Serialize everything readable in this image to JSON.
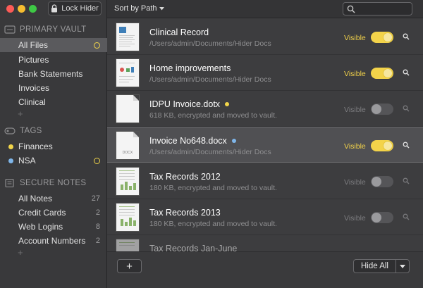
{
  "titlebar": {
    "lock_label": "Lock Hider"
  },
  "toolbar": {
    "sort_label": "Sort by Path",
    "search_placeholder": ""
  },
  "sidebar": {
    "vault_header": "PRIMARY VAULT",
    "vault_items": [
      {
        "label": "All Files",
        "selected": true
      },
      {
        "label": "Pictures"
      },
      {
        "label": "Bank Statements"
      },
      {
        "label": "Invoices"
      },
      {
        "label": "Clinical"
      }
    ],
    "tags_header": "TAGS",
    "tags": [
      {
        "label": "Finances",
        "color": "#f1d54a"
      },
      {
        "label": "NSA",
        "color": "#7fb6ea"
      }
    ],
    "notes_header": "SECURE NOTES",
    "notes": [
      {
        "label": "All Notes",
        "count": "27"
      },
      {
        "label": "Credit Cards",
        "count": "2"
      },
      {
        "label": "Web Logins",
        "count": "8"
      },
      {
        "label": "Account Numbers",
        "count": "2"
      }
    ]
  },
  "files": [
    {
      "name": "Clinical Record",
      "sub": "/Users/admin/Documents/Hider Docs",
      "status": "Visible",
      "visible": true
    },
    {
      "name": "Home improvements",
      "sub": "/Users/admin/Documents/Hider Docs",
      "status": "Visible",
      "visible": true
    },
    {
      "name": "IDPU Invoice.dotx",
      "sub": "618 KB, encrypted and moved to vault.",
      "status": "Visible",
      "visible": false,
      "tag_color": "#f1d54a"
    },
    {
      "name": "Invoice No648.docx",
      "sub": "/Users/admin/Documents/Hider Docs",
      "status": "Visible",
      "visible": true,
      "tag_color": "#7fb6ea",
      "selected": true,
      "thumb_label": "DOCX"
    },
    {
      "name": "Tax Records 2012",
      "sub": "180 KB, encrypted and moved to vault.",
      "status": "Visible",
      "visible": false
    },
    {
      "name": "Tax Records 2013",
      "sub": "180 KB, encrypted and moved to vault.",
      "status": "Visible",
      "visible": false
    },
    {
      "name": "Tax Records Jan-June",
      "sub": "",
      "status": "",
      "visible": false
    }
  ],
  "footer": {
    "add_label": "+",
    "hide_all_label": "Hide All"
  },
  "colors": {
    "accent": "#f3d34a",
    "tag_blue": "#7fb6ea"
  }
}
